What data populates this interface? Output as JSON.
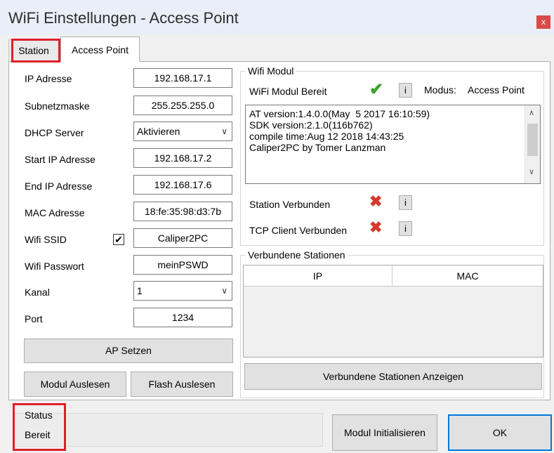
{
  "window": {
    "title": "WiFi Einstellungen - Access Point",
    "close_glyph": "x"
  },
  "tabs": [
    {
      "label": "Station"
    },
    {
      "label": "Access Point"
    }
  ],
  "form": {
    "ip_label": "IP Adresse",
    "ip_value": "192.168.17.1",
    "subnet_label": "Subnetzmaske",
    "subnet_value": "255.255.255.0",
    "dhcp_label": "DHCP Server",
    "dhcp_value": "Aktivieren",
    "start_ip_label": "Start IP Adresse",
    "start_ip_value": "192.168.17.2",
    "end_ip_label": "End IP Adresse",
    "end_ip_value": "192.168.17.6",
    "mac_label": "MAC Adresse",
    "mac_value": "18:fe:35:98:d3:7b",
    "ssid_label": "Wifi SSID",
    "ssid_checked_glyph": "✔",
    "ssid_value": "Caliper2PC",
    "password_label": "Wifi Passwort",
    "password_value": "meinPSWD",
    "channel_label": "Kanal",
    "channel_value": "1",
    "port_label": "Port",
    "port_value": "1234",
    "ap_button": "AP Setzen",
    "read_module_button": "Modul Auslesen",
    "read_flash_button": "Flash Auslesen"
  },
  "wifi_module": {
    "group_title": "Wifi Modul",
    "ready_label": "WiFi Modul Bereit",
    "mode_label": "Modus:",
    "mode_value": "Access Point",
    "info_glyph": "i",
    "log_lines": [
      "AT version:1.4.0.0(May  5 2017 16:10:59)",
      "SDK version:2.1.0(116b762)",
      "compile time:Aug 12 2018 14:43:25",
      "Caliper2PC by Tomer Lanzman"
    ],
    "station_connected_label": "Station Verbunden",
    "tcp_client_label": "TCP Client Verbunden"
  },
  "stations": {
    "group_title": "Verbundene Stationen",
    "columns": [
      "IP",
      "MAC"
    ],
    "show_button": "Verbundene Stationen Anzeigen"
  },
  "status": {
    "title": "Status",
    "value": "Bereit",
    "init_button": "Modul Initialisieren",
    "ok_button": "OK"
  },
  "icons": {
    "check": "check-green-icon",
    "error": "x-red-icon"
  },
  "colors": {
    "highlight": "#e0202a",
    "ok_border": "#0078d7",
    "tick": "#3ea12f",
    "error": "#d43a2c"
  }
}
